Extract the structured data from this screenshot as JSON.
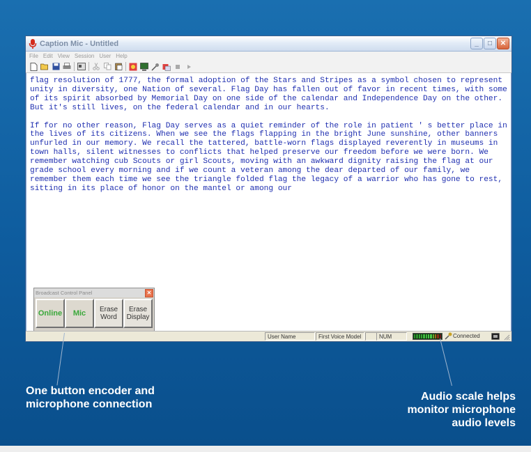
{
  "window": {
    "title": "Caption Mic - Untitled",
    "menu": [
      "File",
      "Edit",
      "View",
      "Session",
      "User",
      "Help"
    ],
    "toolbar_icons": [
      "new-icon",
      "open-icon",
      "save-icon",
      "print-icon",
      "properties-icon",
      "cut-icon",
      "copy-icon",
      "paste-icon",
      "caption-icon",
      "display-icon",
      "mic-settings-icon",
      "encoder-icon",
      "stop-icon",
      "play-icon"
    ],
    "caption_buttons": {
      "minimize": "_",
      "maximize": "□",
      "close": "✕"
    }
  },
  "document": {
    "paragraphs": [
      "flag resolution of 1777, the formal adoption of the Stars and Stripes as a symbol chosen to represent unity in diversity, one Nation of several. Flag Day has fallen out of favor in recent times, with some of its spirit absorbed by Memorial Day on one side of the calendar and Independence Day on the other. But it's still lives, on the federal calendar and in our hearts.",
      "If for no other reason, Flag Day serves as a quiet reminder of the role in patient ' s better place in the lives of its citizens. When we see the flags flapping in the bright June sunshine, other banners unfurled in our memory. We recall the tattered, battle-worn flags displayed reverently in museums in town halls, silent witnesses to conflicts that helped preserve our freedom before we were born. We remember watching cub Scouts or girl Scouts, moving with an awkward dignity raising the flag at our grade school every morning and if we count a veteran among the dear departed of our family, we remember them each time we see the triangle folded flag the legacy of a warrior who has gone to rest, sitting in its place of honor on the mantel or among our"
    ]
  },
  "broadcast_panel": {
    "title": "Broadcast Control Panel",
    "close": "✕",
    "buttons": {
      "online": "Online",
      "mic": "Mic",
      "erase_word": "Erase Word",
      "erase_display": "Erase Display"
    }
  },
  "statusbar": {
    "user_name": "User Name",
    "voice_model": "First Voice Model",
    "num": "NUM",
    "connection": "Connected"
  },
  "callouts": {
    "left": "One button encoder and microphone connection",
    "right": "Audio scale helps monitor microphone audio levels"
  },
  "colors": {
    "background": "#1565a8",
    "text": "#1f2fb0",
    "accent_green": "#3aa83a",
    "close_red": "#d8643a"
  }
}
